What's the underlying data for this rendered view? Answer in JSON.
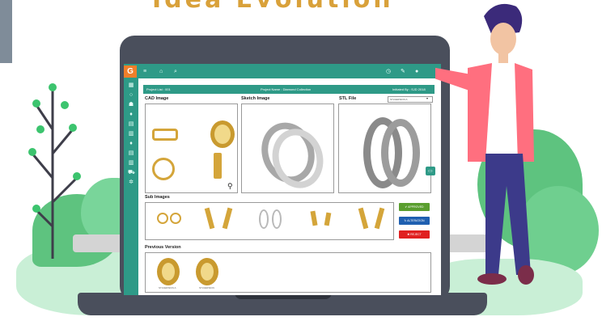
{
  "hero": {
    "title": "Idea Evolution"
  },
  "topbar": {
    "logo_letter": "G"
  },
  "project": {
    "list": "Project List : 001",
    "name": "Project Name : Diamond Collection",
    "initiated": "Initiated By : SJD 2018"
  },
  "sections": {
    "cad": "CAD Image",
    "sketch": "Sketch Image",
    "stl": "STL File",
    "sub": "Sub Images",
    "previous": "Previous Version"
  },
  "stl_select": {
    "value": "STLVERSION A"
  },
  "buttons": {
    "approved": "APPROVED",
    "alteration": "ALTERATION",
    "reject": "REJECT"
  },
  "previous_versions": [
    "STLVERSION A",
    "STLVERSION"
  ],
  "colors": {
    "teal": "#2e9a87",
    "gold": "#d9a13a",
    "approved": "#5a9e2f",
    "alteration": "#1f5fb0",
    "reject": "#e02020"
  },
  "icons": [
    "menu-icon",
    "home-icon",
    "search-icon",
    "clock-icon",
    "edit-icon",
    "user-icon",
    "zoom-icon",
    "feedback-icon"
  ]
}
